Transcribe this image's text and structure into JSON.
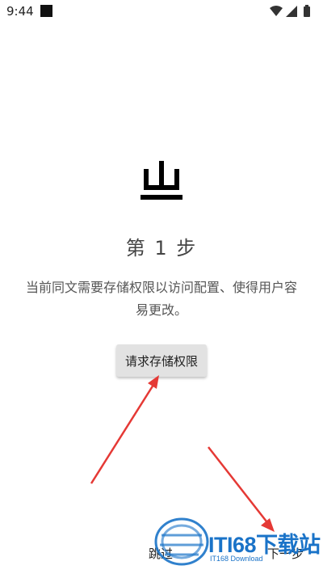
{
  "status_bar": {
    "time": "9:44",
    "icons": [
      "wifi-icon",
      "signal-icon",
      "battery-icon"
    ]
  },
  "app": {
    "logo_icon": "storage-glyph-icon"
  },
  "step": {
    "title": "第 1 步",
    "description": "当前同文需要存储权限以访问配置、使得用户容易更改。",
    "button_label": "请求存储权限"
  },
  "nav": {
    "skip_label": "跳过",
    "next_label": "下一步"
  },
  "watermark": {
    "brand": "ITI68下载站",
    "sub": "IT168 Download"
  },
  "colors": {
    "annotation_arrow": "#e53935",
    "watermark": "#1a73c8"
  }
}
